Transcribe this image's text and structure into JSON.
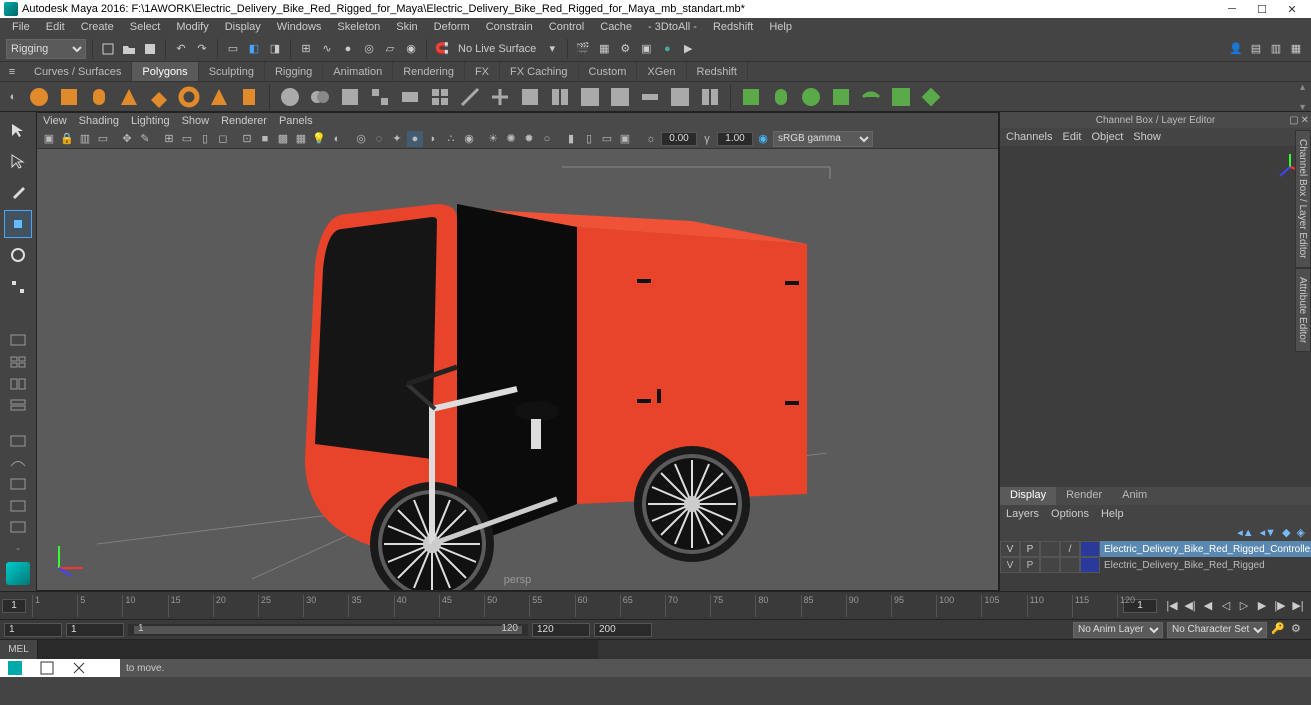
{
  "app": {
    "title": "Autodesk Maya 2016: F:\\1AWORK\\Electric_Delivery_Bike_Red_Rigged_for_Maya\\Electric_Delivery_Bike_Red_Rigged_for_Maya_mb_standart.mb*"
  },
  "menus": [
    "File",
    "Edit",
    "Create",
    "Select",
    "Modify",
    "Display",
    "Windows",
    "Skeleton",
    "Skin",
    "Deform",
    "Constrain",
    "Control",
    "Cache",
    "- 3DtoAll -",
    "Redshift",
    "Help"
  ],
  "status": {
    "menuset": "Rigging",
    "no_live_surface": "No Live Surface"
  },
  "shelf_tabs": [
    "Curves / Surfaces",
    "Polygons",
    "Sculpting",
    "Rigging",
    "Animation",
    "Rendering",
    "FX",
    "FX Caching",
    "Custom",
    "XGen",
    "Redshift"
  ],
  "shelf_active": "Polygons",
  "viewport": {
    "menus": [
      "View",
      "Shading",
      "Lighting",
      "Show",
      "Renderer",
      "Panels"
    ],
    "exposure": "0.00",
    "gamma": "1.00",
    "color_space": "sRGB gamma",
    "camera_label": "persp"
  },
  "right_panel": {
    "title": "Channel Box / Layer Editor",
    "channel_menus": [
      "Channels",
      "Edit",
      "Object",
      "Show"
    ],
    "layer_tabs": [
      "Display",
      "Render",
      "Anim"
    ],
    "layer_tabs_active": "Display",
    "layer_menus": [
      "Layers",
      "Options",
      "Help"
    ],
    "layers": [
      {
        "v": "V",
        "p": "P",
        "t": "",
        "shade": "/",
        "color": "#2a3a9a",
        "name": "Electric_Delivery_Bike_Red_Rigged_Controllers",
        "selected": true
      },
      {
        "v": "V",
        "p": "P",
        "t": "",
        "shade": "",
        "color": "#2a3a9a",
        "name": "Electric_Delivery_Bike_Red_Rigged",
        "selected": false
      }
    ]
  },
  "vertical_tabs": [
    "Channel Box / Layer Editor",
    "Attribute Editor"
  ],
  "timeline": {
    "current": "1",
    "ticks": [
      "1",
      "5",
      "10",
      "15",
      "20",
      "25",
      "30",
      "35",
      "40",
      "45",
      "50",
      "55",
      "60",
      "65",
      "70",
      "75",
      "80",
      "85",
      "90",
      "95",
      "100",
      "105",
      "110",
      "115",
      "120"
    ]
  },
  "range": {
    "start_outer": "1",
    "start_inner": "1",
    "bar_start": "1",
    "bar_end": "120",
    "end_inner": "120",
    "end_outer": "200",
    "anim_layer": "No Anim Layer",
    "char_set": "No Character Set"
  },
  "cmd": {
    "label": "MEL"
  },
  "helpline": {
    "text": "to move."
  }
}
